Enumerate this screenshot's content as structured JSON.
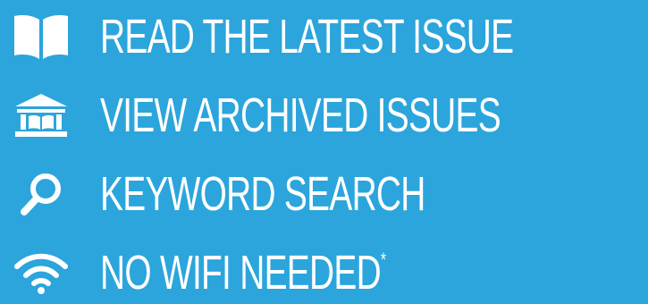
{
  "colors": {
    "background": "#2ba5dc",
    "foreground": "#ffffff"
  },
  "features": [
    {
      "icon": "open-book-icon",
      "label": "READ THE LATEST ISSUE"
    },
    {
      "icon": "library-building-icon",
      "label": "VIEW ARCHIVED ISSUES"
    },
    {
      "icon": "magnifying-glass-icon",
      "label": "KEYWORD SEARCH"
    },
    {
      "icon": "wifi-icon",
      "label": "NO WIFI NEEDED",
      "footnote_mark": "*"
    }
  ]
}
